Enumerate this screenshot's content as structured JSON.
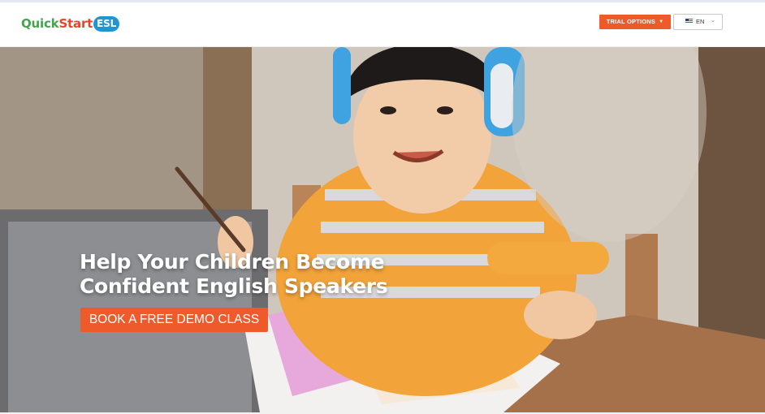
{
  "header": {
    "logo": {
      "quick": "Quick",
      "start": "Start",
      "esl": "ESL"
    },
    "trial_options_label": "TRIAL OPTIONS",
    "language": {
      "code": "EN"
    }
  },
  "hero": {
    "title_line1": "Help Your Children Become",
    "title_line2": "Confident English Speakers",
    "cta_label": "BOOK A FREE DEMO CLASS"
  },
  "colors": {
    "accent_orange": "#ef5a2a",
    "logo_green": "#3fa64c",
    "logo_red": "#e8432c",
    "logo_blue": "#1f95d1"
  }
}
